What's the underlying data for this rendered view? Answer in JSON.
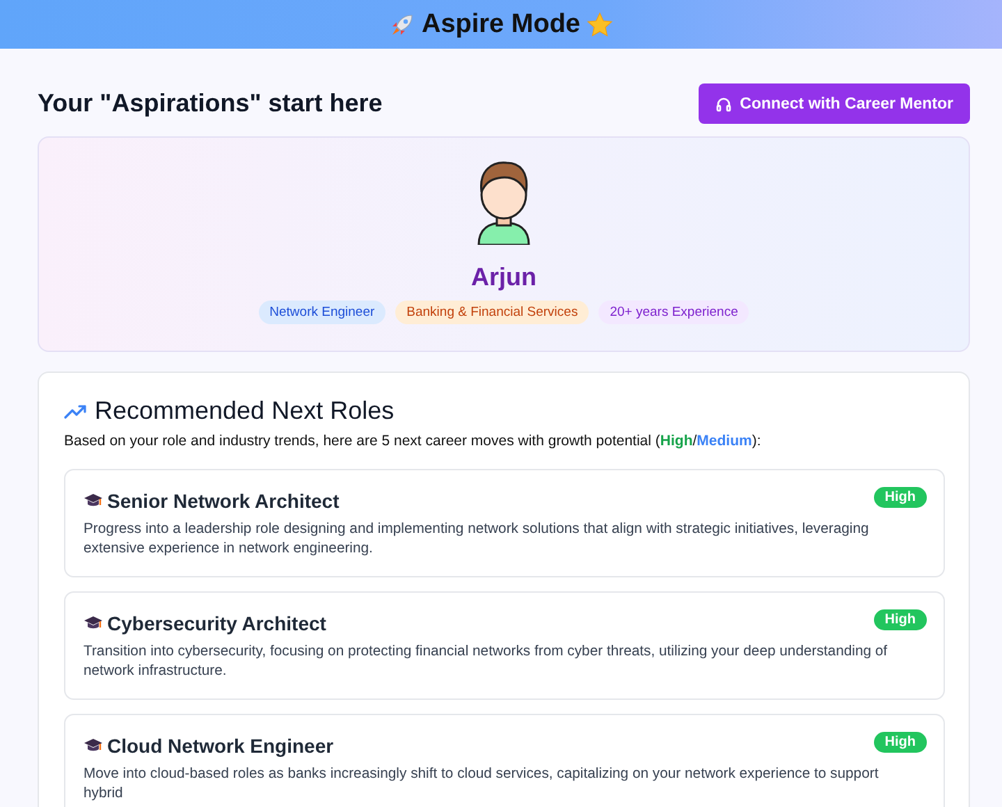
{
  "header": {
    "title": "Aspire Mode"
  },
  "page_title": "Your \"Aspirations\" start here",
  "mentor_button": "Connect with Career Mentor",
  "profile": {
    "name": "Arjun",
    "tags": [
      {
        "label": "Network Engineer",
        "color": "#1d4ed8"
      },
      {
        "label": "Banking & Financial Services",
        "color": "#c2410c"
      },
      {
        "label": "20+ years Experience",
        "color": "#7e22ce"
      }
    ]
  },
  "recommendations": {
    "title": "Recommended Next Roles",
    "intro": {
      "before": "Based on your role and industry trends, here are 5 next career moves with growth potential (",
      "high": "High",
      "separator": "/",
      "medium": "Medium",
      "after": "):"
    },
    "roles": [
      {
        "title": "Senior Network Architect",
        "potential": "High",
        "color": "#22c55e",
        "description": "Progress into a leadership role designing and implementing network solutions that align with strategic initiatives, leveraging extensive experience in network engineering."
      },
      {
        "title": "Cybersecurity Architect",
        "potential": "High",
        "color": "#22c55e",
        "description": "Transition into cybersecurity, focusing on protecting financial networks from cyber threats, utilizing your deep understanding of network infrastructure."
      },
      {
        "title": "Cloud Network Engineer",
        "potential": "High",
        "color": "#22c55e",
        "description": "Move into cloud-based roles as banks increasingly shift to cloud services, capitalizing on your network experience to support hybrid"
      }
    ]
  }
}
